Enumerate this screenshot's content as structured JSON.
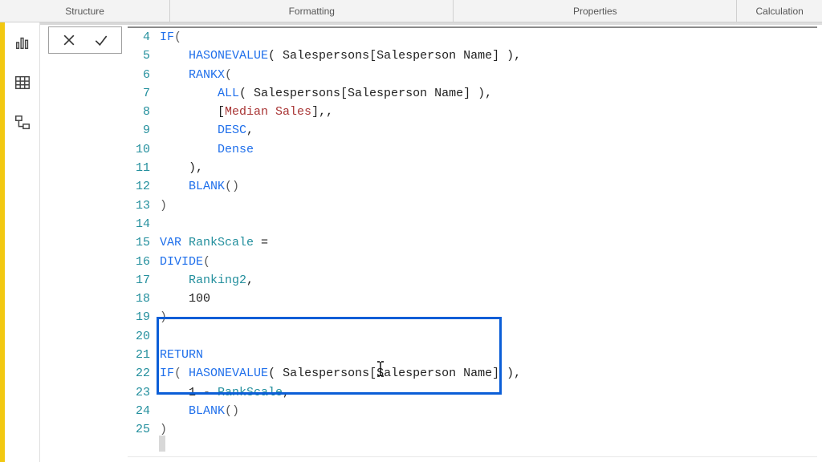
{
  "tabs": {
    "structure": "Structure",
    "formatting": "Formatting",
    "properties": "Properties",
    "calculation": "Calculation"
  },
  "code_lines": [
    {
      "n": 4,
      "tokens": [
        {
          "t": "IF",
          "c": "kw"
        },
        {
          "t": "(",
          "c": "br"
        }
      ]
    },
    {
      "n": 5,
      "indent": 1,
      "tokens": [
        {
          "t": "HASONEVALUE",
          "c": "kw"
        },
        {
          "t": "( Salespersons[Salesperson Name] ),",
          "c": ""
        }
      ]
    },
    {
      "n": 6,
      "indent": 1,
      "tokens": [
        {
          "t": "RANKX",
          "c": "kw"
        },
        {
          "t": "(",
          "c": "br"
        }
      ]
    },
    {
      "n": 7,
      "indent": 2,
      "tokens": [
        {
          "t": "ALL",
          "c": "kw"
        },
        {
          "t": "( Salespersons[Salesperson Name] ),",
          "c": ""
        }
      ]
    },
    {
      "n": 8,
      "indent": 2,
      "tokens": [
        {
          "t": "[",
          "c": ""
        },
        {
          "t": "Median Sales",
          "c": "darkred"
        },
        {
          "t": "],,",
          "c": ""
        }
      ]
    },
    {
      "n": 9,
      "indent": 2,
      "tokens": [
        {
          "t": "DESC",
          "c": "kw"
        },
        {
          "t": ",",
          "c": ""
        }
      ]
    },
    {
      "n": 10,
      "indent": 2,
      "tokens": [
        {
          "t": "Dense",
          "c": "kw"
        }
      ]
    },
    {
      "n": 11,
      "indent": 1,
      "tokens": [
        {
          "t": "),",
          "c": ""
        }
      ]
    },
    {
      "n": 12,
      "indent": 1,
      "tokens": [
        {
          "t": "BLANK",
          "c": "kw"
        },
        {
          "t": "()",
          "c": "br"
        }
      ]
    },
    {
      "n": 13,
      "tokens": [
        {
          "t": ")",
          "c": "br"
        }
      ]
    },
    {
      "n": 14,
      "tokens": []
    },
    {
      "n": 15,
      "tokens": [
        {
          "t": "VAR",
          "c": "kw"
        },
        {
          "t": " ",
          "c": ""
        },
        {
          "t": "RankScale",
          "c": "var"
        },
        {
          "t": " =",
          "c": ""
        }
      ]
    },
    {
      "n": 16,
      "tokens": [
        {
          "t": "DIVIDE",
          "c": "kw"
        },
        {
          "t": "(",
          "c": "br"
        }
      ]
    },
    {
      "n": 17,
      "indent": 1,
      "tokens": [
        {
          "t": "Ranking2",
          "c": "var"
        },
        {
          "t": ",",
          "c": ""
        }
      ]
    },
    {
      "n": 18,
      "indent": 1,
      "tokens": [
        {
          "t": "100",
          "c": ""
        }
      ]
    },
    {
      "n": 19,
      "tokens": [
        {
          "t": ")",
          "c": "br"
        }
      ]
    },
    {
      "n": 20,
      "tokens": []
    },
    {
      "n": 21,
      "tokens": [
        {
          "t": "RETURN",
          "c": "kw"
        }
      ]
    },
    {
      "n": 22,
      "tokens": [
        {
          "t": "IF",
          "c": "kw"
        },
        {
          "t": "( ",
          "c": "br"
        },
        {
          "t": "HASONEVALUE",
          "c": "kw"
        },
        {
          "t": "( Salespersons[Salesperson Name] ),",
          "c": ""
        }
      ]
    },
    {
      "n": 23,
      "indent": 1,
      "tokens": [
        {
          "t": "1 - ",
          "c": ""
        },
        {
          "t": "RankScale",
          "c": "var"
        },
        {
          "t": ",",
          "c": ""
        }
      ]
    },
    {
      "n": 24,
      "indent": 1,
      "tokens": [
        {
          "t": "BLANK",
          "c": "kw"
        },
        {
          "t": "()",
          "c": "br"
        }
      ]
    },
    {
      "n": 25,
      "tokens": [
        {
          "t": ")",
          "c": "br"
        }
      ]
    }
  ],
  "indent_unit": "    "
}
